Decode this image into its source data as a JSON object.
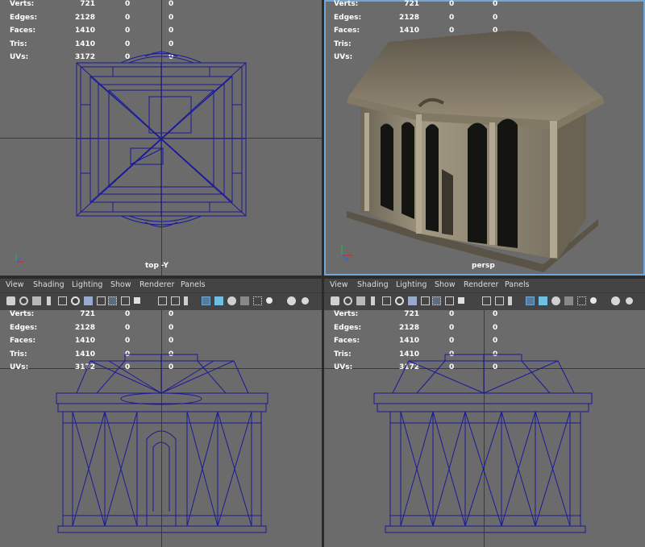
{
  "hud_rows": [
    {
      "label": "Verts:",
      "v1": "721",
      "v2": "0",
      "v3": "0"
    },
    {
      "label": "Edges:",
      "v1": "2128",
      "v2": "0",
      "v3": "0"
    },
    {
      "label": "Faces:",
      "v1": "1410",
      "v2": "0",
      "v3": "0"
    },
    {
      "label": "Tris:",
      "v1": "1410",
      "v2": "0",
      "v3": "0"
    },
    {
      "label": "UVs:",
      "v1": "3172",
      "v2": "0",
      "v3": "0"
    }
  ],
  "viewports": {
    "top": {
      "camera_label": "top -Y"
    },
    "persp": {
      "camera_label": "persp"
    }
  },
  "menu": {
    "items": [
      "View",
      "Shading",
      "Lighting",
      "Show",
      "Renderer",
      "Panels"
    ]
  },
  "toolbar_icons": [
    "camera-icon",
    "camera-attributes-icon",
    "bookmark-icon",
    "image-plane-icon",
    "grid-icon",
    "film-gate-icon",
    "resolution-gate-icon",
    "gate-mask-icon",
    "field-chart-icon",
    "safe-action-icon",
    "safe-title-icon",
    "wireframe-icon",
    "smooth-shade-icon",
    "default-material-icon",
    "textured-icon",
    "use-lights-icon",
    "shadows-icon",
    "ambient-occlusion-icon",
    "xray-icon",
    "isolate-select-icon",
    "xray-joints-icon"
  ],
  "colors": {
    "viewport_bg": "#6b6b6b",
    "wireframe": "#1a1a9a",
    "panel_bg": "#444444",
    "active_highlight": "#6fa7d8"
  }
}
